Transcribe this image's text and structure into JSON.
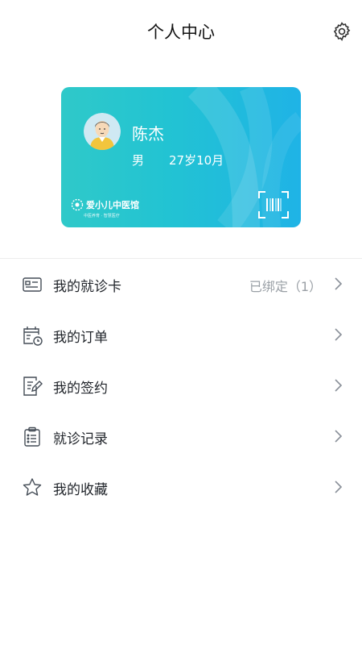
{
  "header": {
    "title": "个人中心",
    "settings_icon": "gear-icon"
  },
  "card": {
    "name": "陈杰",
    "gender": "男",
    "age": "27岁10月",
    "brand": "爱小儿中医馆",
    "brand_sub": "中医养育 · 智慧医疗",
    "avatar_icon": "user-avatar-icon",
    "scan_icon": "barcode-scan-icon",
    "colors": {
      "gradient_start": "#2fc9c9",
      "gradient_end": "#1fb3e6"
    }
  },
  "menu": [
    {
      "label": "我的就诊卡",
      "status": "已绑定（1）",
      "icon": "id-card-icon"
    },
    {
      "label": "我的订单",
      "status": "",
      "icon": "calendar-clock-icon"
    },
    {
      "label": "我的签约",
      "status": "",
      "icon": "document-edit-icon"
    },
    {
      "label": "就诊记录",
      "status": "",
      "icon": "clipboard-list-icon"
    },
    {
      "label": "我的收藏",
      "status": "",
      "icon": "star-icon"
    }
  ]
}
